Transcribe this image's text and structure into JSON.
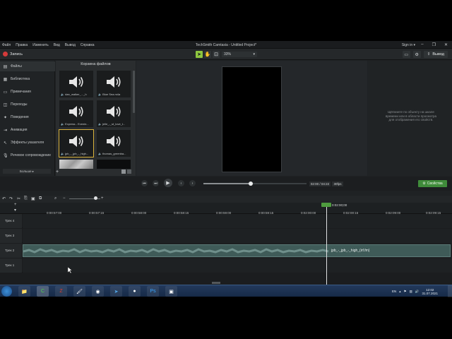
{
  "window": {
    "title": "TechSmith Camtasia - Untitled Project*",
    "menu": [
      "Файл",
      "Правка",
      "Изменить",
      "Вид",
      "Вывод",
      "Справка"
    ],
    "signin": "Sign in ▾",
    "controls": [
      "–",
      "❐",
      "✕"
    ]
  },
  "toolbar": {
    "record_label": "Запись",
    "zoom_value": "33%",
    "export_label": "Вывод"
  },
  "nav": {
    "items": [
      {
        "label": "Файлы",
        "icon": "film-icon"
      },
      {
        "label": "Библиотека",
        "icon": "library-icon"
      },
      {
        "label": "Примечания",
        "icon": "annotation-icon"
      },
      {
        "label": "Переходы",
        "icon": "transition-icon"
      },
      {
        "label": "Поведения",
        "icon": "behavior-icon"
      },
      {
        "label": "Анимация",
        "icon": "animation-icon"
      },
      {
        "label": "Эффекты указателя",
        "icon": "cursor-effect-icon"
      },
      {
        "label": "Речевое сопровождение",
        "icon": "microphone-icon"
      }
    ],
    "more_label": "Больше ▸"
  },
  "bin": {
    "title": "Корзина файлов",
    "items": [
      {
        "caption": "🔈 dan_walker_..._h",
        "kind": "audio"
      },
      {
        "caption": "🔈 Blue Sea.m4a",
        "kind": "audio"
      },
      {
        "caption": "🔈 Express - Eveniн...",
        "kind": "audio"
      },
      {
        "caption": "🔈 jelle_-_st_love_t...",
        "kind": "audio"
      },
      {
        "caption": "🔈 jpb_-_jpb_-_high...",
        "kind": "audio"
      },
      {
        "caption": "🔈 thomas_greenba...",
        "kind": "audio"
      },
      {
        "caption": "",
        "kind": "image"
      },
      {
        "caption": "",
        "kind": "dark"
      }
    ]
  },
  "properties": {
    "message": "Щёлкните по объекту на шкале времени или в области просмотра для отображения его свойств."
  },
  "playback": {
    "time_current": "02:00",
    "time_total": "04:22",
    "time_text": "02:00 / 04:22",
    "fps": "30fps",
    "progress": 0.458,
    "properties_label": "Свойства"
  },
  "timeline": {
    "playhead_time": "0:02:00;00",
    "ruler_ticks": [
      "0:00:57;00",
      "0:00:57;15",
      "0:00:58;00",
      "0:00:58;15",
      "0:00:59;00",
      "0:00:59;15",
      "0:02:00;00",
      "0:02:00;15",
      "0:02:09;00",
      "0:02:09;15"
    ],
    "tracks": [
      {
        "name": "Трек 4",
        "clip": ""
      },
      {
        "name": "Трек 3",
        "clip": ""
      },
      {
        "name": "Трек 2",
        "clip": "jpb_-_jpb_-_high_(irf.fm)"
      },
      {
        "name": "Трек 1",
        "clip": ""
      }
    ]
  },
  "taskbar": {
    "apps": [
      "explorer",
      "camtasia",
      "filezilla",
      "paint",
      "chrome",
      "telegram",
      "obs",
      "photoshop",
      "recorder"
    ],
    "lang": "EN",
    "time": "12:02",
    "date": "31.07.2021"
  }
}
